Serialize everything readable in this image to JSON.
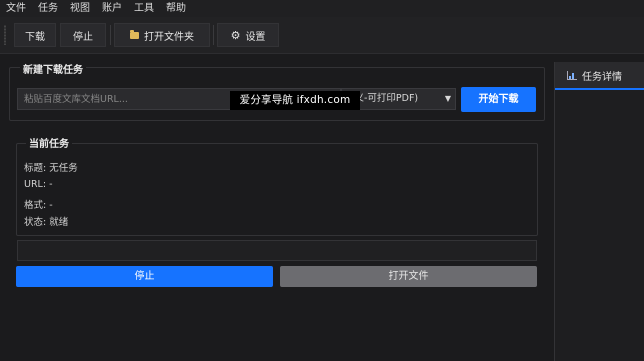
{
  "menu": [
    "文件",
    "任务",
    "视图",
    "账户",
    "工具",
    "帮助"
  ],
  "toolbar": {
    "download": "下载",
    "stop": "停止",
    "open_folder": "打开文件夹",
    "settings": "设置",
    "folder_icon": "folder-icon",
    "gear_icon": "gear-icon"
  },
  "new_task": {
    "title": "新建下载任务",
    "url_placeholder": "粘贴百度文库文档URL...",
    "format_value": "定义-可打印PDF)",
    "start_button": "开始下载"
  },
  "watermark": "爱分享导航 ifxdh.com",
  "current_task": {
    "title": "当前任务",
    "title_line": "标题: 无任务",
    "url_line": "URL: -",
    "format_line": "格式: -",
    "status_line": "状态: 就绪",
    "progress": 0
  },
  "actions": {
    "stop": "停止",
    "open_file": "打开文件"
  },
  "dock": {
    "tab_label": "任务详情"
  },
  "colors": {
    "accent": "#1673ff",
    "background": "#1b1b1d",
    "disabled_button": "#6c6c70"
  }
}
